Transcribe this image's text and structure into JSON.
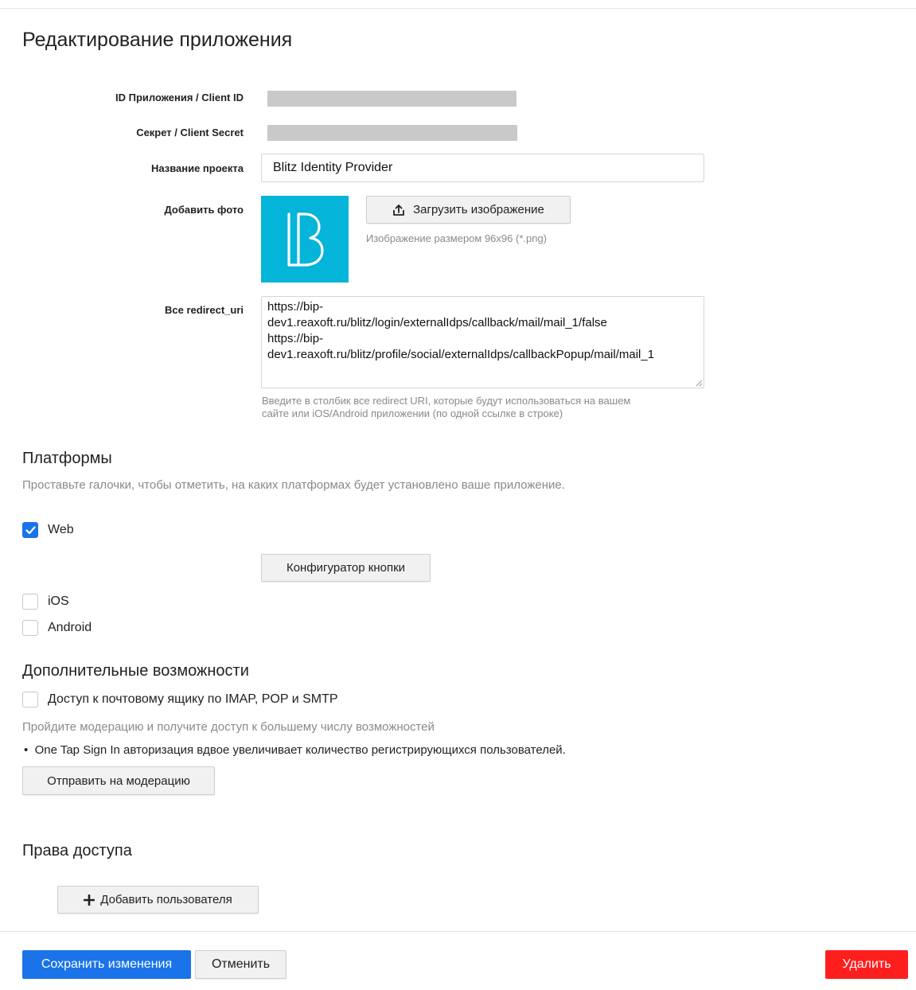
{
  "page": {
    "title": "Редактирование приложения"
  },
  "fields": {
    "client_id_label": "ID Приложения / Client ID",
    "client_secret_label": "Секрет / Client Secret",
    "project_name_label": "Название проекта",
    "project_name_value": "Blitz Identity Provider",
    "photo_label": "Добавить фото",
    "upload_button": "Загрузить изображение",
    "upload_hint": "Изображение размером 96x96 (*.png)",
    "redirect_label": "Все redirect_uri",
    "redirect_value": "https://bip-\ndev1.reaxoft.ru/blitz/login/externalIdps/callback/mail/mail_1/false\nhttps://bip-\ndev1.reaxoft.ru/blitz/profile/social/externalIdps/callbackPopup/mail/mail_1",
    "redirect_hint_line1": "Введите в столбик все redirect URI, которые будут использоваться на вашем",
    "redirect_hint_line2": "сайте или iOS/Android приложении (по одной ссылке в строке)"
  },
  "platforms": {
    "title": "Платформы",
    "description": "Проставьте галочки, чтобы отметить, на каких платформах будет установлено ваше приложение.",
    "items": [
      {
        "label": "Web",
        "checked": true
      },
      {
        "label": "iOS",
        "checked": false
      },
      {
        "label": "Android",
        "checked": false
      }
    ],
    "configurator_button": "Конфигуратор кнопки"
  },
  "extras": {
    "title": "Дополнительные возможности",
    "mail_access_label": "Доступ к почтовому ящику по IMAP, POP и SMTP",
    "mail_access_checked": false,
    "moderation_hint": "Пройдите модерацию и получите доступ к большему числу возможностей",
    "bullet": "One Tap Sign In авторизация вдвое увеличивает количество регистрирующихся пользователей.",
    "moderation_button": "Отправить на модерацию"
  },
  "access": {
    "title": "Права доступа",
    "add_user_button": "Добавить пользователя"
  },
  "footer": {
    "save_button": "Сохранить изменения",
    "cancel_button": "Отменить",
    "delete_button": "Удалить"
  },
  "colors": {
    "primary": "#1a73e8",
    "danger": "#ff1e1e",
    "logo_bg": "#04b4d9"
  }
}
